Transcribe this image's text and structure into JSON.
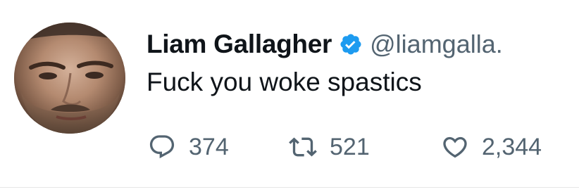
{
  "tweet": {
    "author": {
      "display_name": "Liam Gallagher",
      "handle": "@liamgalla.",
      "verified": true
    },
    "text": "Fuck you woke spastics",
    "actions": {
      "replies": "374",
      "retweets": "521",
      "likes": "2,344"
    },
    "icons": {
      "reply": "reply-icon",
      "retweet": "retweet-icon",
      "like": "heart-icon",
      "verified": "verified-badge-icon"
    },
    "colors": {
      "text": "#0f1419",
      "secondary": "#536471",
      "verified_blue": "#1d9bf0"
    }
  }
}
